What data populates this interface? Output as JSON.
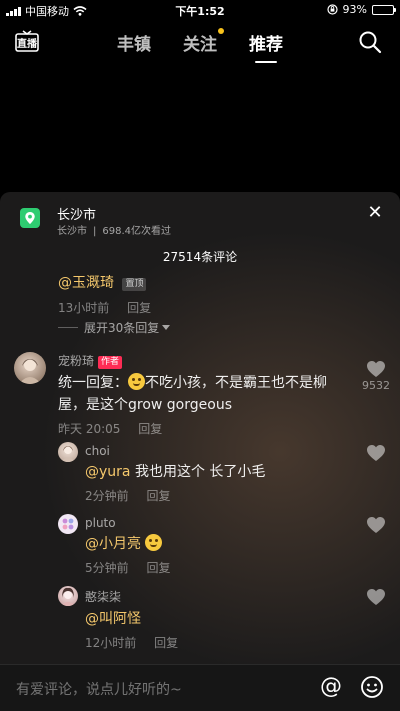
{
  "status_bar": {
    "carrier": "中国移动",
    "time": "下午1:52",
    "battery": "93%",
    "battery_level": 0.93
  },
  "topnav": {
    "live_label": "直播",
    "tabs": [
      {
        "label": "丰镇"
      },
      {
        "label": "关注"
      },
      {
        "label": "推荐"
      }
    ]
  },
  "location": {
    "title": "长沙市",
    "city": "长沙市",
    "views": "698.4亿次看过"
  },
  "comment_count": "27514条评论",
  "comments": {
    "c0": {
      "mention": "@玉溉琦",
      "badge": "置顶",
      "time": "13小时前",
      "reply": "回复"
    },
    "expand": "展开30条回复",
    "c1": {
      "name": "宠粉琦",
      "badge": "作者",
      "text_prefix": "统一回复：",
      "text_rest": "不吃小孩，不是霸王也不是柳屋，是这个grow gorgeous",
      "time": "昨天 20:05",
      "reply": "回复",
      "likes": "9532"
    },
    "r1": {
      "name": "choi",
      "mention": "@yura",
      "text": " 我也用这个 长了小毛",
      "time": "2分钟前",
      "reply": "回复"
    },
    "r2": {
      "name": "pluto",
      "mention": "@小月亮",
      "time": "5分钟前",
      "reply": "回复"
    },
    "r3": {
      "name": "憨柒柒",
      "mention": "@叫阿怪",
      "time": "12小时前",
      "reply": "回复"
    }
  },
  "input": {
    "placeholder": "有爱评论，说点儿好听的~",
    "at_label": "@"
  }
}
